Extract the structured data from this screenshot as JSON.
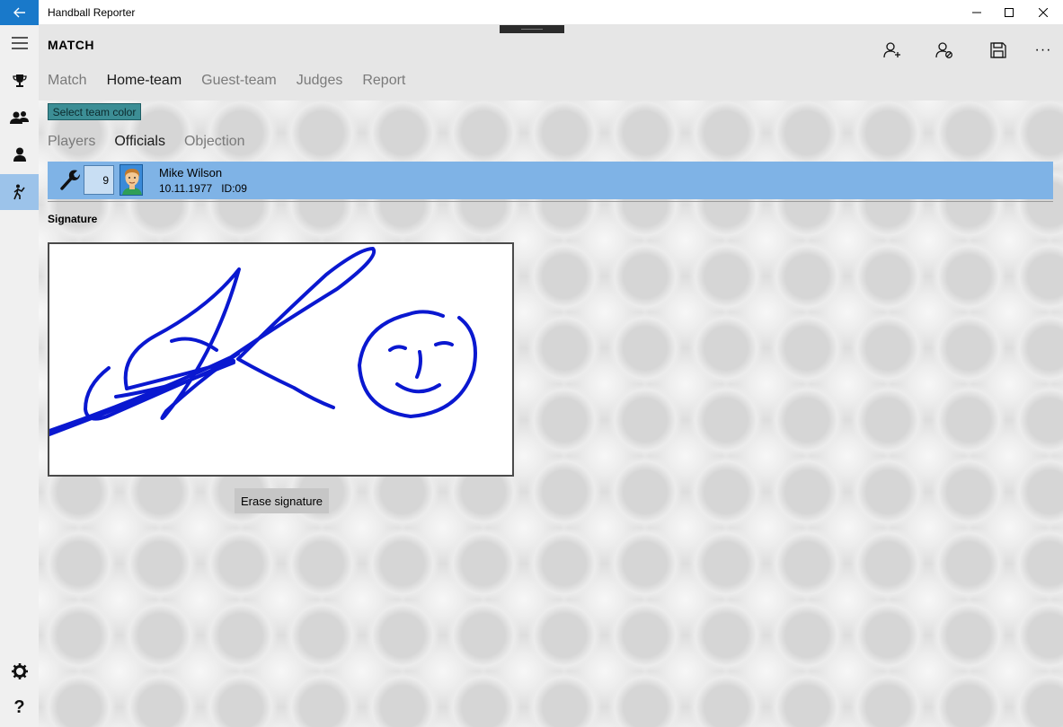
{
  "window": {
    "title": "Handball Reporter"
  },
  "header": {
    "page_title": "MATCH"
  },
  "tabs": [
    {
      "label": "Match",
      "selected": false
    },
    {
      "label": "Home-team",
      "selected": true
    },
    {
      "label": "Guest-team",
      "selected": false
    },
    {
      "label": "Judges",
      "selected": false
    },
    {
      "label": "Report",
      "selected": false
    }
  ],
  "team_color_button": "Select team color",
  "subtabs": [
    {
      "label": "Players",
      "selected": false
    },
    {
      "label": "Officials",
      "selected": true
    },
    {
      "label": "Objection",
      "selected": false
    }
  ],
  "official": {
    "number": "9",
    "name": "Mike Wilson",
    "birthdate": "10.11.1977",
    "id": "ID:09"
  },
  "signature": {
    "label": "Signature",
    "erase_label": "Erase signature",
    "ink_color": "#0a18d0"
  },
  "colors": {
    "accent": "#1979ca",
    "selected_row": "#7fb3e6",
    "team_color": "#3c8e95"
  },
  "icons": {
    "back": "arrow-left-icon",
    "menu": "hamburger-icon",
    "rail": [
      "trophy-icon",
      "team-icon",
      "person-icon",
      "referee-icon"
    ],
    "rail_bottom": [
      "gear-icon",
      "help-icon"
    ],
    "commands": [
      "add-person-icon",
      "remove-person-icon",
      "save-icon",
      "more-icon"
    ]
  }
}
